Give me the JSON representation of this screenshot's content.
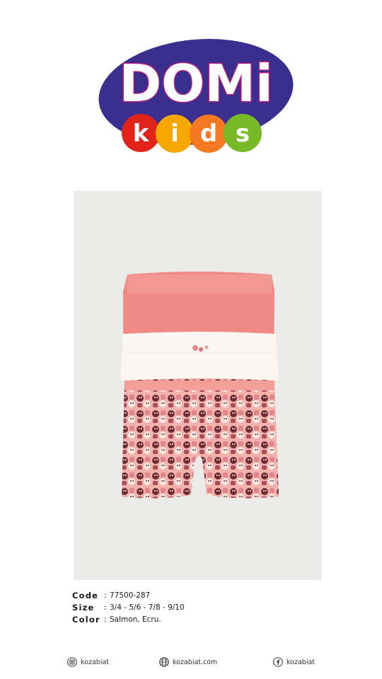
{
  "brand": {
    "logo_main": "DOMi",
    "logo_sub": [
      "k",
      "i",
      "d",
      "s"
    ],
    "colors": {
      "oval": "#3a2f8f",
      "text": "#ffffff",
      "outline": "#b11e7c",
      "k": "#e2231a",
      "i": "#f7a800",
      "d": "#f47920",
      "s": "#78b928"
    }
  },
  "product": {
    "colors": {
      "salmon": "#f08a85",
      "ecru": "#fbf6f2",
      "print_dark": "#6d2b33"
    }
  },
  "specs": [
    {
      "label": "Code",
      "value": "77500-287"
    },
    {
      "label": "Size",
      "value": "3/4 - 5/6 - 7/8 - 9/10"
    },
    {
      "label": "Color",
      "value": "Salmon, Ecru."
    }
  ],
  "footer": {
    "instagram": {
      "icon": "instagram-icon",
      "text": "kozabiat"
    },
    "web": {
      "icon": "globe-icon",
      "text": "kozabiat.com"
    },
    "facebook": {
      "icon": "facebook-icon",
      "text": "kozabiat"
    }
  }
}
